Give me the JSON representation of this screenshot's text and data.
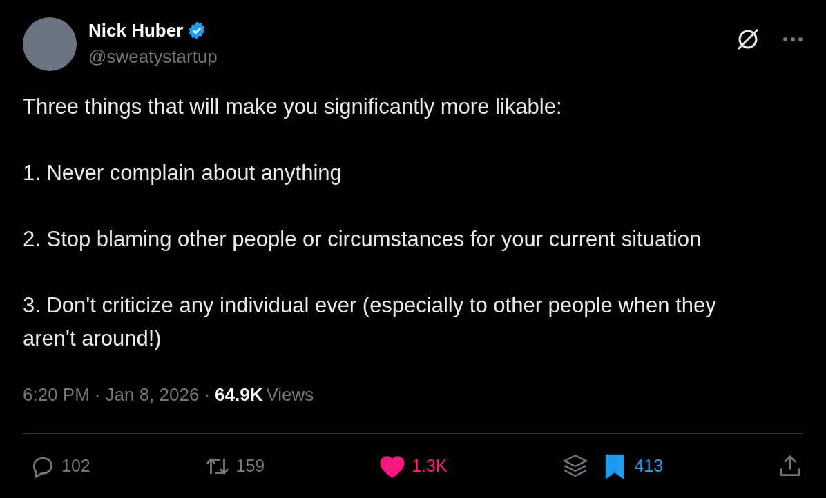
{
  "author": {
    "name": "Nick Huber",
    "verified": true,
    "handle": "@sweatystartup"
  },
  "paragraphs": [
    "Three things that will make you significantly more likable:",
    "1. Never complain about anything",
    "2. Stop blaming other people or circumstances for your current situation",
    "3. Don't criticize any individual ever (especially to other people when they aren't around!)"
  ],
  "meta": {
    "time": "6:20 PM",
    "separator": "·",
    "date": "Jan 8, 2026",
    "separator_2": "·",
    "views_count": "64.9K",
    "views_label": "Views"
  },
  "actions": [
    {
      "kind": "reply",
      "count": "102"
    },
    {
      "kind": "repost",
      "count": "159"
    },
    {
      "kind": "like",
      "count": "1.3K",
      "active": true
    },
    {
      "kind": "bookmark",
      "count": "413",
      "active": true
    },
    {
      "kind": "share"
    }
  ]
}
